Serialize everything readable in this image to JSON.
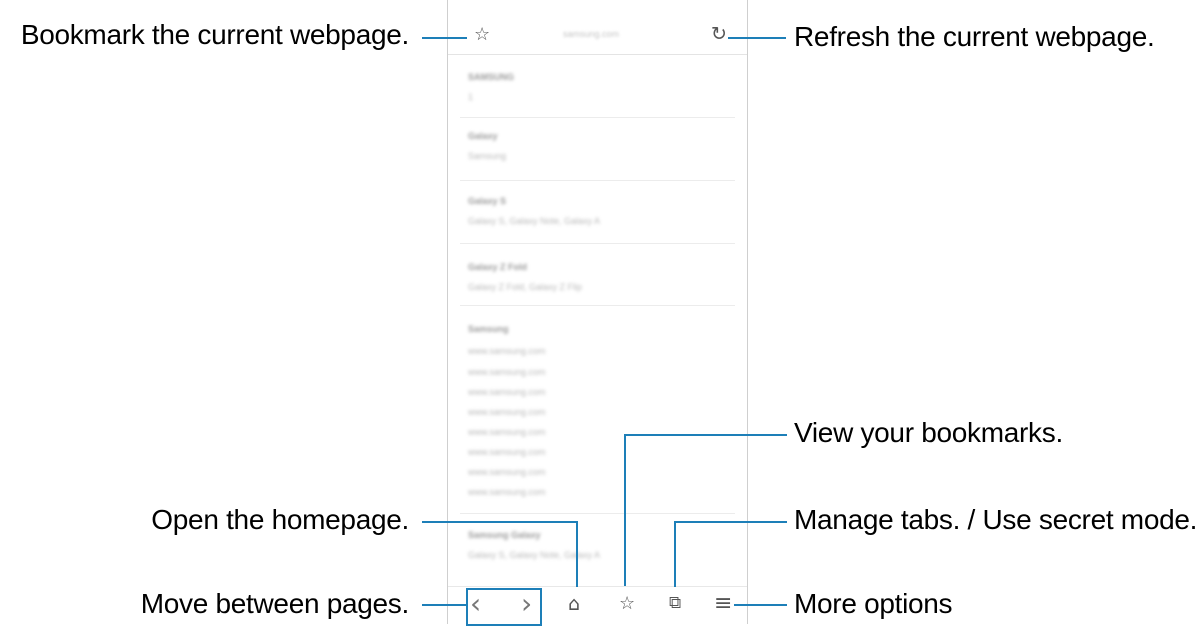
{
  "browser": {
    "url_text": "samsung.com",
    "content_sections": [
      {
        "title": "SAMSUNG",
        "lines": [
          "1"
        ]
      },
      {
        "title": "Galaxy",
        "lines": [
          "Samsung"
        ]
      },
      {
        "title": "Galaxy S",
        "lines": [
          "Galaxy S, Galaxy Note, Galaxy A"
        ]
      },
      {
        "title": "Galaxy Z Fold",
        "lines": [
          "Galaxy Z Fold, Galaxy Z Flip"
        ]
      },
      {
        "title": "Samsung",
        "lines": [
          "www.samsung.com",
          "www.samsung.com",
          "www.samsung.com",
          "www.samsung.com",
          "www.samsung.com",
          "www.samsung.com",
          "www.samsung.com",
          "www.samsung.com"
        ]
      },
      {
        "title": "Samsung Galaxy",
        "lines": [
          "Galaxy S, Galaxy Note, Galaxy A"
        ]
      }
    ]
  },
  "icons": {
    "bookmark_add": "☆",
    "refresh": "↻",
    "back": "‹",
    "forward": "›",
    "home": "⌂",
    "bookmarks": "☆",
    "tabs": "⧉",
    "menu": "≡"
  },
  "callouts": {
    "bookmark": "Bookmark the current webpage.",
    "refresh": "Refresh the current webpage.",
    "view_bookmarks": "View your bookmarks.",
    "homepage": "Open the homepage.",
    "tabs": "Manage tabs. / Use secret mode.",
    "move_pages": "Move between pages.",
    "more_options": "More options"
  },
  "colors": {
    "callout_line": "#1d7fb8",
    "phone_border": "#cfcfcf"
  }
}
